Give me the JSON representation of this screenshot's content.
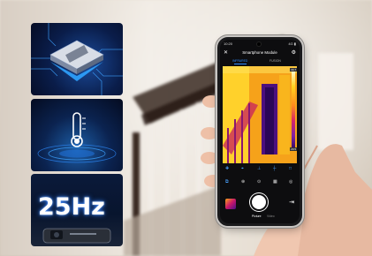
{
  "banner": {
    "hz_label": "25Hz"
  },
  "phone": {
    "status_time": "10:20",
    "status_right": "4G ▮",
    "app_title": "Smartphone Module",
    "tabs": [
      "INFRARED",
      "FUSION"
    ],
    "active_tab": "INFRARED",
    "scale_max": "30.7",
    "scale_min": "20.5",
    "tool_icons": [
      "plus-icon",
      "crosshair-icon",
      "probe-icon",
      "box-icon",
      "more-icon"
    ],
    "mode_icons": [
      "palette-icon",
      "target-icon",
      "distance-icon",
      "grid-icon",
      "circle-icon"
    ],
    "modes": [
      "Picture",
      "Video"
    ],
    "active_mode": "Picture"
  },
  "colors": {
    "accent": "#2f8cff",
    "thermal_yellow": "#f7a418",
    "thermal_purple": "#4a0e8a",
    "tile_blue": "#0a1d4a"
  }
}
